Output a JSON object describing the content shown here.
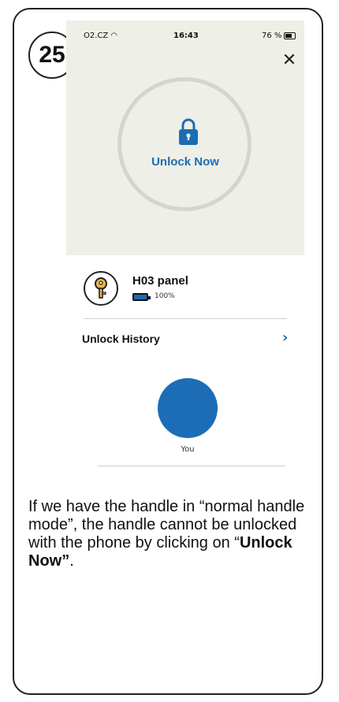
{
  "step": {
    "number": "25"
  },
  "status_bar": {
    "carrier": "O2.CZ",
    "time": "16:43",
    "battery": "76 %"
  },
  "unlock": {
    "label": "Unlock Now"
  },
  "device": {
    "name": "H03 panel",
    "battery": "100%"
  },
  "history": {
    "label": "Unlock History",
    "user": "You"
  },
  "caption": {
    "text_before": "If we have the handle in “normal handle mode”, the handle cannot be unlocked with the phone by clicking on “",
    "bold": "Unlock Now”",
    "text_after": "."
  },
  "colors": {
    "accent": "#1c6db5",
    "screen_bg": "#eeefe6"
  }
}
